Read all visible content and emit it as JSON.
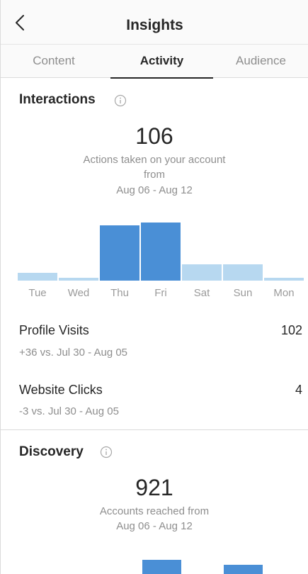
{
  "header": {
    "title": "Insights",
    "back_icon": "chevron-left-icon"
  },
  "tabs": [
    {
      "label": "Content",
      "active": false
    },
    {
      "label": "Activity",
      "active": true
    },
    {
      "label": "Audience",
      "active": false
    }
  ],
  "interactions": {
    "title": "Interactions",
    "info_icon": "info-circle-icon",
    "total": "106",
    "caption_line1": "Actions taken on your account",
    "caption_line2": "from",
    "date_range": "Aug 06 - Aug 12",
    "days": [
      "Tue",
      "Wed",
      "Thu",
      "Fri",
      "Sat",
      "Sun",
      "Mon"
    ],
    "bar_levels": [
      0.14,
      0.05,
      0.95,
      1.0,
      0.28,
      0.28,
      0.05
    ],
    "highlight": [
      false,
      false,
      true,
      true,
      false,
      false,
      false
    ],
    "colors": {
      "light": "#b7d8f0",
      "dark": "#4a8fd6"
    },
    "stats": [
      {
        "label": "Profile Visits",
        "value": "102",
        "change": "+36 vs. Jul 30 - Aug 05"
      },
      {
        "label": "Website Clicks",
        "value": "4",
        "change": "-3 vs. Jul 30 - Aug 05"
      }
    ]
  },
  "discovery": {
    "title": "Discovery",
    "info_icon": "info-circle-icon",
    "total": "921",
    "caption_line1": "Accounts reached from",
    "date_range": "Aug 06 - Aug 12"
  }
}
